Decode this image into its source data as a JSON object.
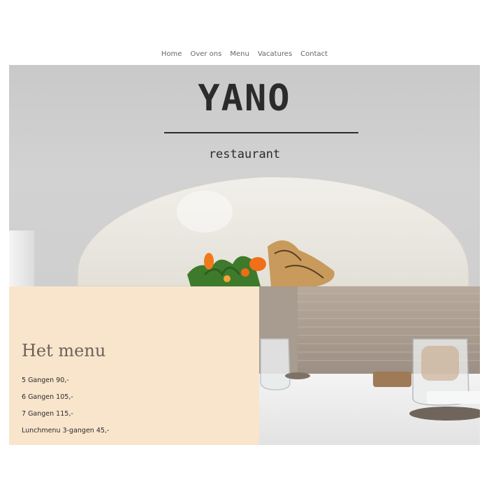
{
  "nav": {
    "items": [
      "Home",
      "Over ons",
      "Menu",
      "Vacatures",
      "Contact"
    ]
  },
  "hero": {
    "logo_title": "YANO",
    "logo_subtitle": "restaurant"
  },
  "menu": {
    "title": "Het menu",
    "items": [
      "5 Gangen 90,-",
      "6 Gangen 105,-",
      "7 Gangen 115,-",
      "Lunchmenu 3-gangen 45,-"
    ]
  },
  "colors": {
    "menu_panel_bg": "#f8e5cc",
    "logo_text": "#2b2b2b",
    "nav_text": "#666666"
  }
}
